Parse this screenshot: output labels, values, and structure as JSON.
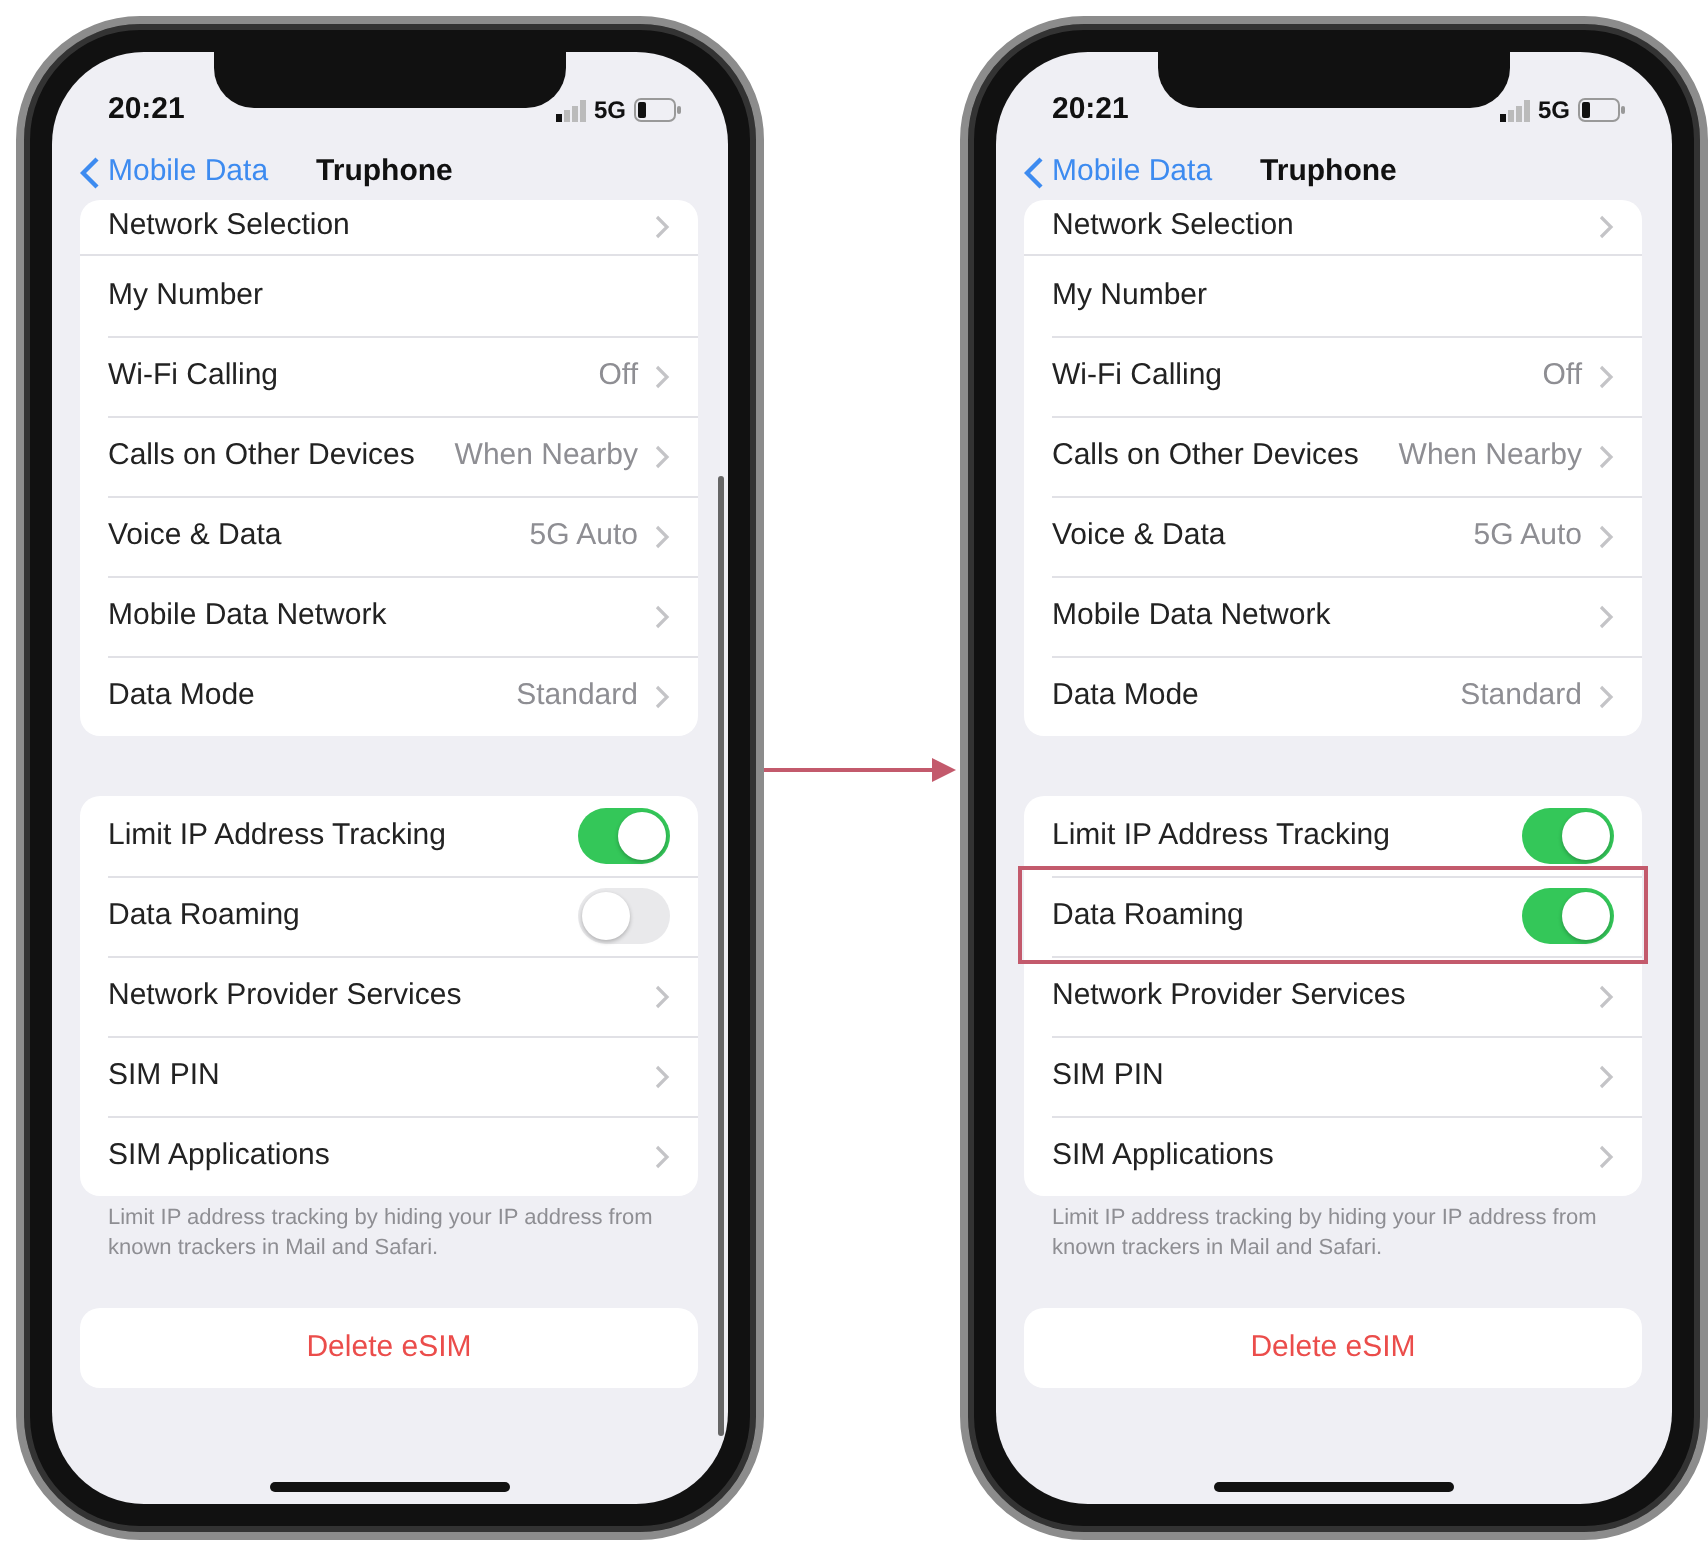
{
  "phones": [
    {
      "time": "20:21",
      "network": "5G",
      "back": "Mobile Data",
      "title": "Truphone",
      "scroll_indicator": true,
      "groups": [
        {
          "rows": [
            {
              "kind": "link",
              "label": "Network Selection",
              "partial": true
            },
            {
              "kind": "plain",
              "label": "My Number"
            },
            {
              "kind": "link",
              "label": "Wi-Fi Calling",
              "value": "Off"
            },
            {
              "kind": "link",
              "label": "Calls on Other Devices",
              "value": "When Nearby"
            },
            {
              "kind": "link",
              "label": "Voice & Data",
              "value": "5G Auto"
            },
            {
              "kind": "link",
              "label": "Mobile Data Network"
            },
            {
              "kind": "link",
              "label": "Data Mode",
              "value": "Standard"
            }
          ]
        },
        {
          "rows": [
            {
              "kind": "toggle",
              "label": "Limit IP Address Tracking",
              "on": true
            },
            {
              "kind": "toggle",
              "label": "Data Roaming",
              "on": false,
              "highlighted": false
            },
            {
              "kind": "link",
              "label": "Network Provider Services"
            },
            {
              "kind": "link",
              "label": "SIM PIN"
            },
            {
              "kind": "link",
              "label": "SIM Applications"
            }
          ],
          "footer": "Limit IP address tracking by hiding your IP address from known trackers in Mail and Safari."
        }
      ],
      "delete_button": "Delete eSIM"
    },
    {
      "time": "20:21",
      "network": "5G",
      "back": "Mobile Data",
      "title": "Truphone",
      "scroll_indicator": false,
      "groups": [
        {
          "rows": [
            {
              "kind": "link",
              "label": "Network Selection",
              "partial": true
            },
            {
              "kind": "plain",
              "label": "My Number"
            },
            {
              "kind": "link",
              "label": "Wi-Fi Calling",
              "value": "Off"
            },
            {
              "kind": "link",
              "label": "Calls on Other Devices",
              "value": "When Nearby"
            },
            {
              "kind": "link",
              "label": "Voice & Data",
              "value": "5G Auto"
            },
            {
              "kind": "link",
              "label": "Mobile Data Network"
            },
            {
              "kind": "link",
              "label": "Data Mode",
              "value": "Standard"
            }
          ]
        },
        {
          "rows": [
            {
              "kind": "toggle",
              "label": "Limit IP Address Tracking",
              "on": true
            },
            {
              "kind": "toggle",
              "label": "Data Roaming",
              "on": true,
              "highlighted": true
            },
            {
              "kind": "link",
              "label": "Network Provider Services"
            },
            {
              "kind": "link",
              "label": "SIM PIN"
            },
            {
              "kind": "link",
              "label": "SIM Applications"
            }
          ],
          "footer": "Limit IP address tracking by hiding your IP address from known trackers in Mail and Safari."
        }
      ],
      "delete_button": "Delete eSIM"
    }
  ]
}
